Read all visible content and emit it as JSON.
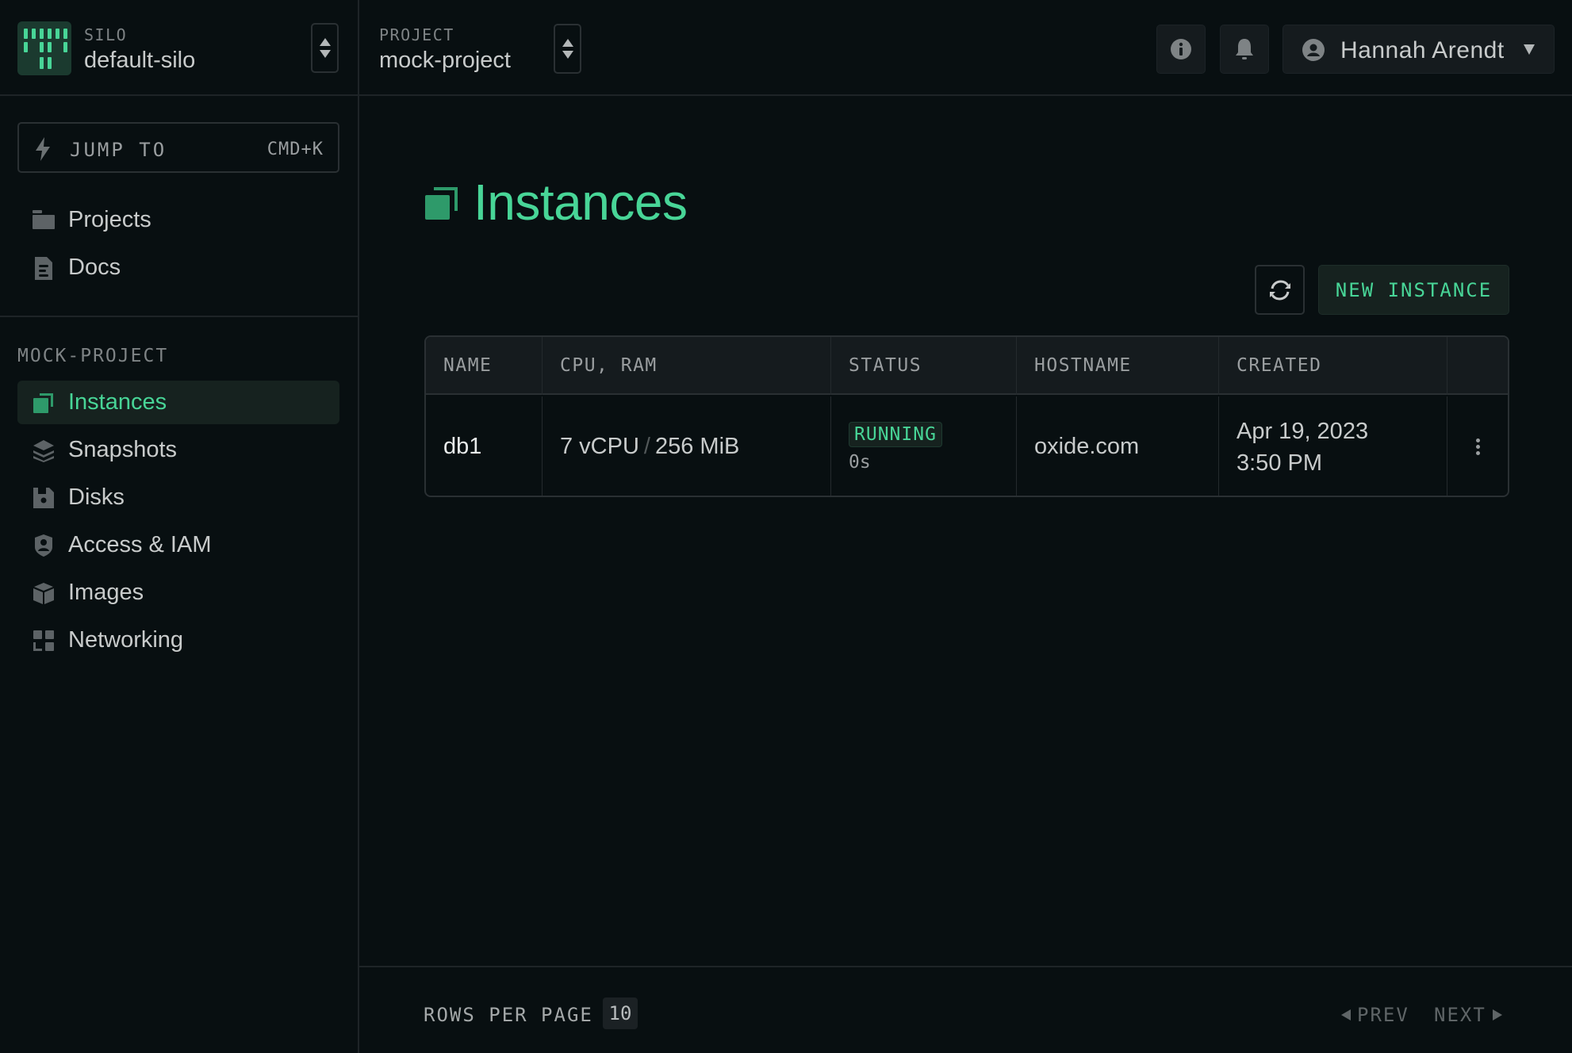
{
  "silo": {
    "label": "SILO",
    "name": "default-silo"
  },
  "project": {
    "label": "PROJECT",
    "name": "mock-project"
  },
  "jump_to": {
    "label": "JUMP TO",
    "shortcut": "CMD+K"
  },
  "sidebar": {
    "global_items": [
      {
        "label": "Projects",
        "icon": "folder-icon"
      },
      {
        "label": "Docs",
        "icon": "document-icon"
      }
    ],
    "section_label": "MOCK-PROJECT",
    "project_items": [
      {
        "label": "Instances",
        "icon": "instances-icon",
        "active": true
      },
      {
        "label": "Snapshots",
        "icon": "layers-icon"
      },
      {
        "label": "Disks",
        "icon": "disk-icon"
      },
      {
        "label": "Access & IAM",
        "icon": "shield-user-icon"
      },
      {
        "label": "Images",
        "icon": "cube-icon"
      },
      {
        "label": "Networking",
        "icon": "grid-icon"
      }
    ]
  },
  "topbar": {
    "info_icon": "info-icon",
    "bell_icon": "bell-icon",
    "user": {
      "name": "Hannah Arendt",
      "icon": "user-circle-icon"
    }
  },
  "page": {
    "title": "Instances",
    "refresh_icon": "refresh-icon",
    "new_button": "NEW INSTANCE"
  },
  "table": {
    "columns": [
      "NAME",
      "CPU, RAM",
      "STATUS",
      "HOSTNAME",
      "CREATED",
      ""
    ],
    "rows": [
      {
        "name": "db1",
        "cpu": "7 vCPU",
        "ram": "256 MiB",
        "separator": "/",
        "status": "RUNNING",
        "status_age": "0s",
        "hostname": "oxide.com",
        "created_date": "Apr 19, 2023",
        "created_time": "3:50 PM"
      }
    ]
  },
  "footer": {
    "rows_per_page_label": "ROWS PER PAGE",
    "rows_per_page_value": "10",
    "prev": "PREV",
    "next": "NEXT"
  },
  "colors": {
    "accent": "#48d597",
    "background": "#080f11",
    "surface": "#151b1e",
    "border": "#2a3033"
  }
}
